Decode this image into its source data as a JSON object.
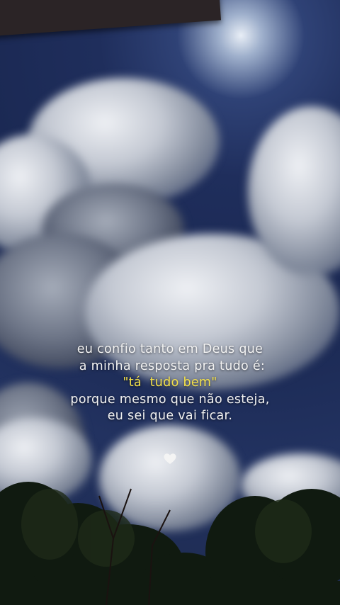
{
  "quote": {
    "line1": "eu confio tanto em Deus que",
    "line2": " a minha resposta pra tudo é:",
    "line3": "\"tá  tudo bem\"",
    "line4": "porque mesmo que não esteja,",
    "line5": "eu sei que vai ficar."
  },
  "colors": {
    "text": "#f2f2f2",
    "highlight": "#f3e04a",
    "sky": "#1f2e5c"
  },
  "icons": {
    "heart": "heart-icon"
  }
}
